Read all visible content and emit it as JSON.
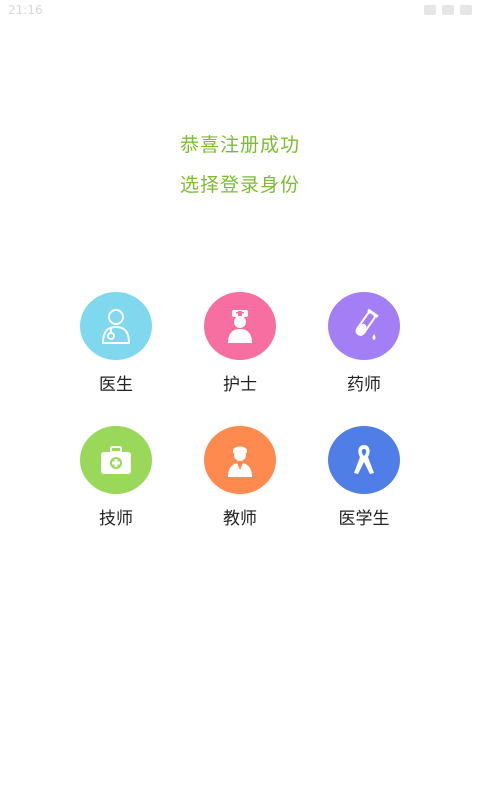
{
  "status_bar": {
    "time": "21:16"
  },
  "header": {
    "congrats": "恭喜注册成功",
    "instruction": "选择登录身份"
  },
  "roles": [
    {
      "label": "医生",
      "icon": "doctor-icon",
      "color": "#7fd8ee"
    },
    {
      "label": "护士",
      "icon": "nurse-icon",
      "color": "#f76fa0"
    },
    {
      "label": "药师",
      "icon": "test-tube-icon",
      "color": "#a37ef5"
    },
    {
      "label": "技师",
      "icon": "medical-kit-icon",
      "color": "#9ad85a"
    },
    {
      "label": "教师",
      "icon": "teacher-icon",
      "color": "#ff8a4f"
    },
    {
      "label": "医学生",
      "icon": "ribbon-icon",
      "color": "#4f7fe6"
    }
  ]
}
